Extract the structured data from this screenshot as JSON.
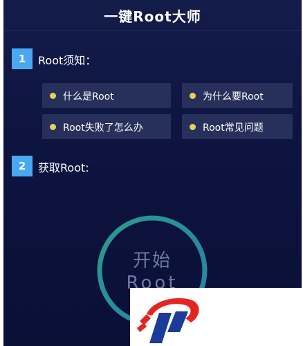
{
  "app": {
    "title": "一键Root大师"
  },
  "section1": {
    "number": "1",
    "title": "Root须知：",
    "items": [
      {
        "label": "什么是Root"
      },
      {
        "label": "为什么要Root"
      },
      {
        "label": "Root失败了怎么办"
      },
      {
        "label": "Root常见问题"
      }
    ]
  },
  "section2": {
    "number": "2",
    "title": "获取Root:"
  },
  "start": {
    "line1": "开始",
    "line2": "Root"
  },
  "colors": {
    "background": "#0d1440",
    "accent_blue": "#4aa8f2",
    "dot_yellow": "#e6d25a",
    "ring_teal": "#2f8f8a",
    "logo_red": "#e52521",
    "logo_blue": "#1a3b9a"
  },
  "icons": {
    "watermark": "brand-logo-icon"
  }
}
